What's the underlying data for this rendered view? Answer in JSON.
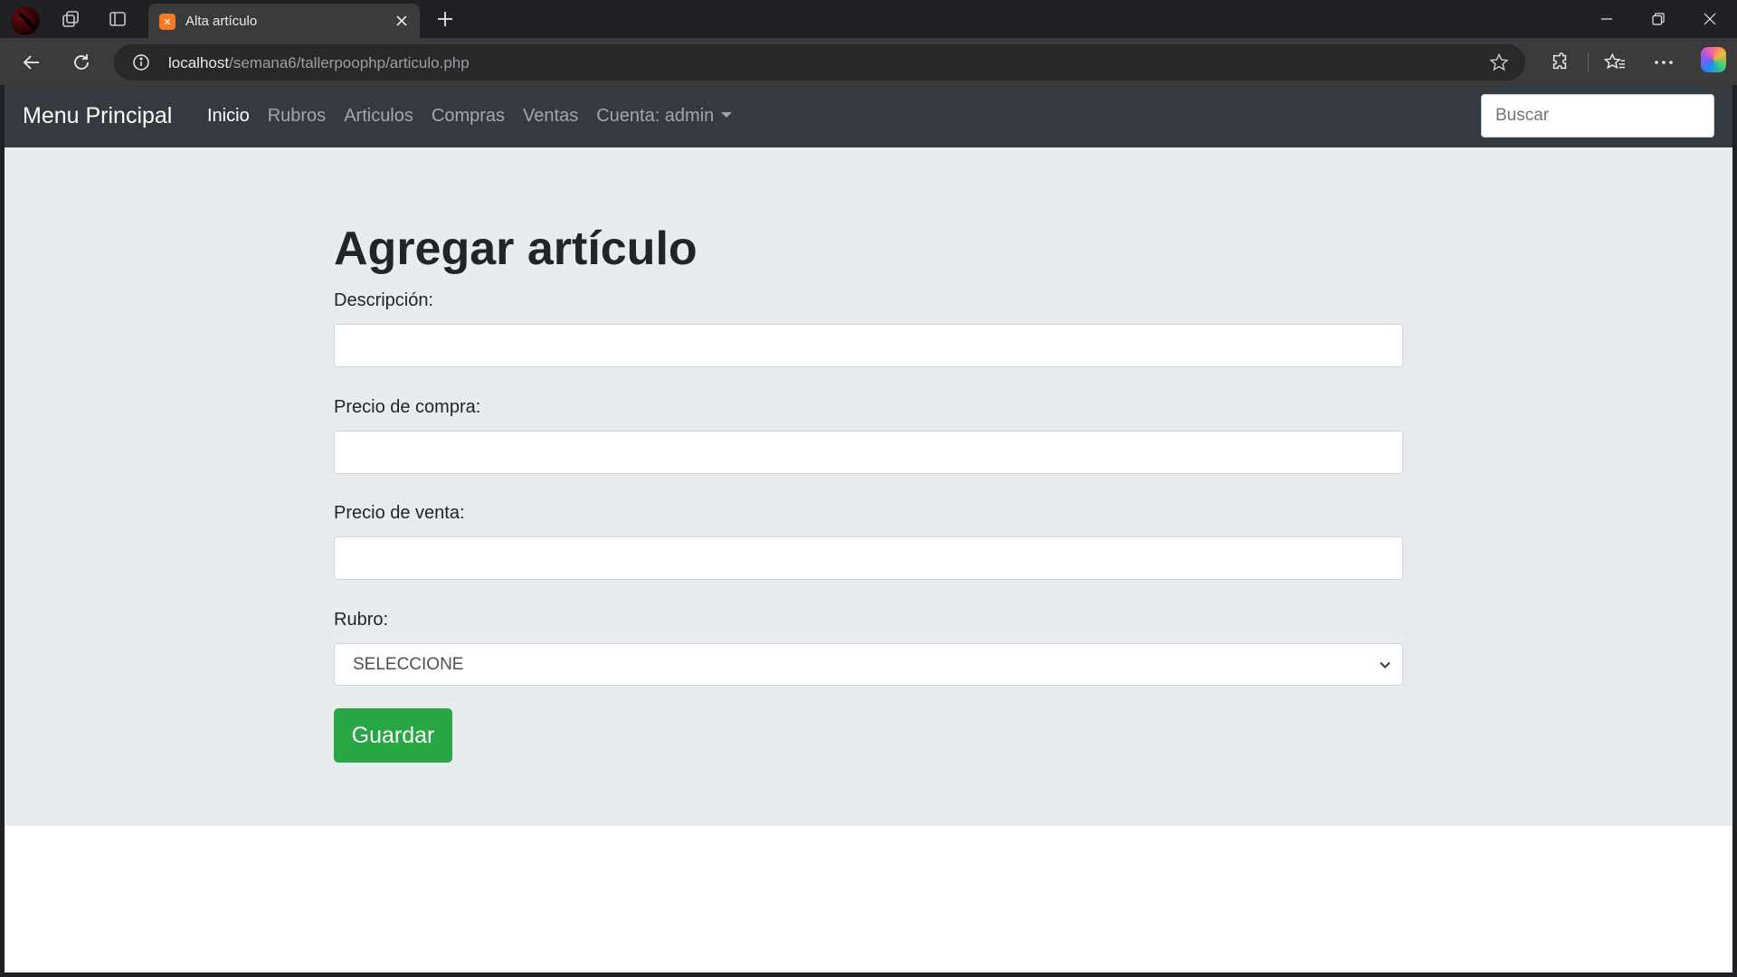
{
  "browser": {
    "tab_title": "Alta artículo",
    "tab_favicon": "xampp-icon",
    "url_host": "localhost",
    "url_path": "/semana6/tallerpoophp/articulo.php"
  },
  "navbar": {
    "brand": "Menu Principal",
    "links": [
      {
        "label": "Inicio",
        "active": true
      },
      {
        "label": "Rubros",
        "active": false
      },
      {
        "label": "Articulos",
        "active": false
      },
      {
        "label": "Compras",
        "active": false
      },
      {
        "label": "Ventas",
        "active": false
      }
    ],
    "account_dropdown": "Cuenta: admin",
    "search_placeholder": "Buscar"
  },
  "form": {
    "title": "Agregar artículo",
    "fields": {
      "descripcion": {
        "label": "Descripción:",
        "value": ""
      },
      "precio_compra": {
        "label": "Precio de compra:",
        "value": ""
      },
      "precio_venta": {
        "label": "Precio de venta:",
        "value": ""
      },
      "rubro": {
        "label": "Rubro:",
        "selected": "SELECCIONE"
      }
    },
    "submit_label": "Guardar"
  },
  "colors": {
    "navbar_bg": "#343a40",
    "jumbotron_bg": "#e9ecef",
    "success": "#28a745"
  }
}
